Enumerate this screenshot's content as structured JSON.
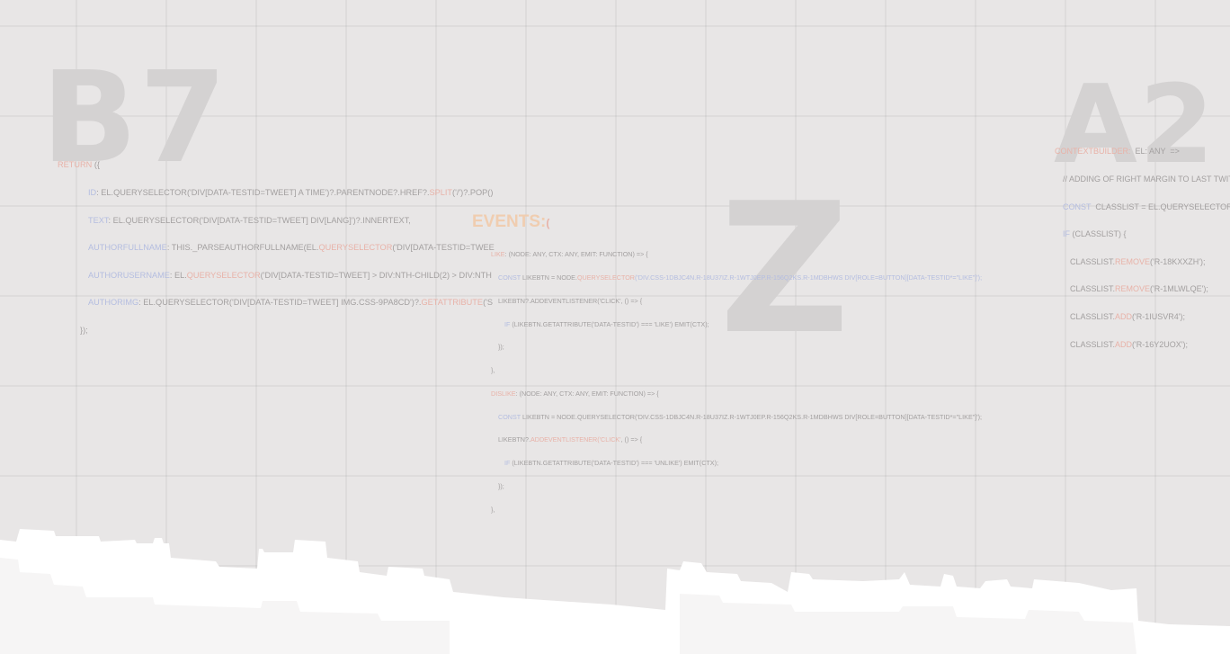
{
  "big_letters": {
    "b7": "B7",
    "a2": "A2",
    "z": "Z"
  },
  "code_b7": {
    "l1_kw": "return",
    "l1_rest": " ({",
    "l2_key": "id",
    "l2_a": ": el.querySelector('div[data-testid=tweet] a time')?.parentNode?.href?.",
    "l2_fn": "split",
    "l2_b": "('/')?.pop()",
    "l3_key": "text",
    "l3_rest": ": el.querySelector('div[data-testid=tweet] div[lang]')?.innerText,",
    "l4_key": "authorFullname",
    "l4_a": ": this._parseAuthorFullname(el.",
    "l4_fn": "querySelector",
    "l4_b": "('div[data-testid=twee",
    "l5_key": "authorUsername",
    "l5_a": ": el.",
    "l5_fn": "querySelector",
    "l5_b": "('div[data-testid=tweet] > div:nth-child(2) > div:nth",
    "l6_key": "authorImg",
    "l6_a": ": el.querySelector('div[data-testid=tweet] img.css-9pa8cd')?.",
    "l6_fn": "getAttribute",
    "l6_b": "('s",
    "l7": "});"
  },
  "code_a2": {
    "l1_key": "contextBuilder:",
    "l1_rest": "  el: any  =>",
    "l2": "// adding of right margin to last twitter",
    "l3_kw": "const",
    "l3_rest": "  classList = el.querySelector('div.",
    "l4_kw": "if",
    "l4_rest": " (classList) {",
    "l5_a": "classList.",
    "l5_fn": "remove",
    "l5_b": "('r-18kxxzh');",
    "l6_a": "classList.",
    "l6_fn": "remove",
    "l6_b": "('r-1mlwlqe');",
    "l7_a": "classList.",
    "l7_fn": "add",
    "l7_b": "('r-1iusvr4');",
    "l8_a": "classList.",
    "l8_fn": "add",
    "l8_b": "('r-16y2uox');"
  },
  "events": {
    "title": "events:",
    "paren": "(",
    "l1_key": "like",
    "l1_rest": ": (node: any, ctx: any, emit: Function) => {",
    "l2_kw": "const",
    "l2_a": " likeBtn = node.",
    "l2_fn": "querySelector",
    "l2_str": "('div.css-1dbjc4n.r-18u37iz.r-1wtj0ep.r-156q2ks.r-1mdbhws div[role=button][data-testid*=\"like\"]');",
    "l3": "likeBtn?.addEventListener('click', () => {",
    "l4_kw": "if",
    "l4_rest": " (likeBtn.getAttribute('data-testid') === 'like') emit(ctx);",
    "l5": "});",
    "l6": "},",
    "l7_key": "dislike",
    "l7_rest": ": (node: any, ctx: any, emit: Function) => {",
    "l8_kw": "const",
    "l8_rest": " likeBtn = node.querySelector('div.css-1dbjc4n.r-18u37iz.r-1wtj0ep.r-156q2ks.r-1mdbhws div[role=button][data-testid*=\"like\"]');",
    "l9_a": "likeBtn?.",
    "l9_fn": "addEventListener",
    "l9_str": "('click'",
    "l9_b": ", () => {",
    "l10_kw": "if",
    "l10_rest": " (likeBtn.getAttribute('data-testid') === 'unlike') emit(ctx);",
    "l11": "});",
    "l12": "},"
  },
  "colors": {
    "background": "#e8e6e6",
    "big_letter": "#d4d2d2",
    "code_text": "#a3a0a0",
    "keyword": "#e8b2a8",
    "property": "#b4bde0",
    "events_title": "#f0cdb0",
    "skyline": "#ffffff"
  }
}
